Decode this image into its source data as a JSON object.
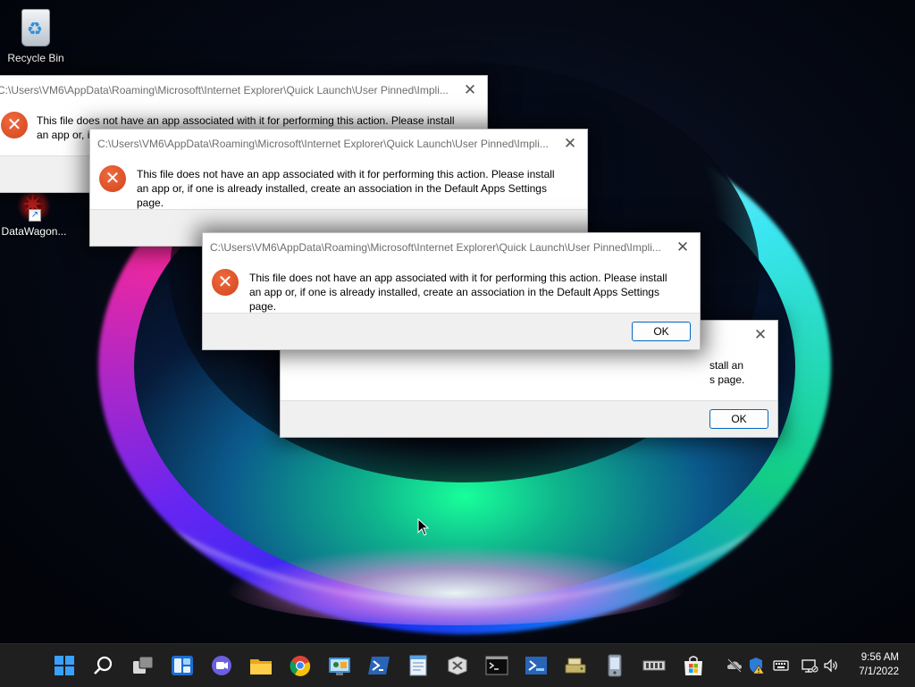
{
  "desktop": {
    "icons": [
      {
        "label": "Recycle Bin",
        "icon": "recycle-bin-icon"
      },
      {
        "label": "DataWagon...",
        "icon": "datawagon-app-icon"
      }
    ]
  },
  "dialogs": [
    {
      "title": "C:\\Users\\VM6\\AppData\\Roaming\\Microsoft\\Internet Explorer\\Quick Launch\\User Pinned\\Impli...",
      "message": "This file does not have an app associated with it for performing this action. Please install an app or, if on",
      "ok_label": ""
    },
    {
      "title": "C:\\Users\\VM6\\AppData\\Roaming\\Microsoft\\Internet Explorer\\Quick Launch\\User Pinned\\Impli...",
      "message": "This file does not have an app associated with it for performing this action. Please install an app or, if one is already installed, create an association in the Default Apps Settings page.",
      "ok_label": ""
    },
    {
      "title": "",
      "message": "stall an\ns page.",
      "ok_label": "OK"
    },
    {
      "title": "C:\\Users\\VM6\\AppData\\Roaming\\Microsoft\\Internet Explorer\\Quick Launch\\User Pinned\\Impli...",
      "message": "This file does not have an app associated with it for performing this action. Please install an app or, if one is already installed, create an association in the Default Apps Settings page.",
      "ok_label": "OK"
    }
  ],
  "taskbar": {
    "apps": [
      "start-icon",
      "search-icon",
      "task-view-icon",
      "widgets-icon",
      "chat-icon",
      "file-explorer-icon",
      "chrome-icon",
      "control-panel-icon",
      "powershell-icon",
      "notepad-icon",
      "xps-viewer-icon",
      "command-prompt-icon",
      "powershell-ise-icon",
      "drive-tool-icon",
      "device-icon",
      "memory-chip-icon",
      "store-icon"
    ],
    "tray_icons": [
      "onedrive-offline-icon",
      "security-warning-icon",
      "keyboard-icon",
      "network-icon",
      "volume-icon"
    ],
    "time": "9:56 AM",
    "date": "7/1/2022"
  }
}
